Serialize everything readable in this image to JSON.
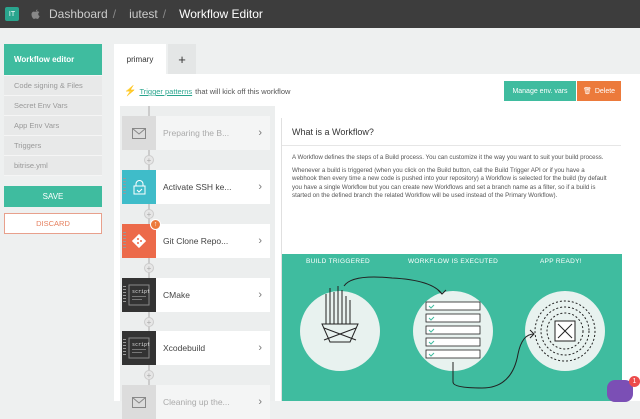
{
  "topbar": {
    "avatar": "IT",
    "breadcrumb": [
      "Dashboard",
      "iutest",
      "Workflow Editor"
    ]
  },
  "sidebar": {
    "items": [
      "Workflow editor",
      "Code signing & Files",
      "Secret Env Vars",
      "App Env Vars",
      "Triggers",
      "bitrise.yml"
    ],
    "save": "SAVE",
    "discard": "DISCARD"
  },
  "tabs": {
    "primary": "primary",
    "add": "+"
  },
  "trigger": {
    "link": "Trigger patterns",
    "text": "that will kick off this workflow"
  },
  "actions": {
    "env_vars": "Manage env. vars",
    "delete": "Delete"
  },
  "steps": [
    {
      "name": "Preparing the B...",
      "icon": "envelope-icon",
      "color": "#dcdcdc"
    },
    {
      "name": "Activate SSH ke...",
      "icon": "lock-icon",
      "color": "#3fbcc9"
    },
    {
      "name": "Git Clone Repo...",
      "icon": "git-icon",
      "color": "#ec6a4a",
      "badge": "↑"
    },
    {
      "name": "CMake",
      "icon": "script-icon",
      "color": "#333333"
    },
    {
      "name": "Xcodebuild",
      "icon": "script-icon",
      "color": "#333333"
    },
    {
      "name": "Cleaning up the...",
      "icon": "envelope-icon",
      "color": "#dcdcdc"
    }
  ],
  "info": {
    "title": "What is a Workflow?",
    "p1": "A Workflow defines the steps of a Build process. You can customize it the way you want to suit your build process.",
    "p2": "Whenever a build is triggered (when you click on the Build button, call the Build Trigger API or if you have a webhook then every time a new code is pushed into your repository) a Workflow is selected for the build (by default you have a single Workflow but you can create new Workflows and set a branch name as a filter, so if a build is started on the defined branch the related Workflow will be used instead of the Primary Workflow).",
    "labels": [
      "BUILD TRIGGERED",
      "WORKFLOW IS EXECUTED",
      "APP READY!"
    ]
  },
  "chat": {
    "count": "1"
  },
  "colors": {
    "accent": "#3fbc9f",
    "danger": "#ec7a3b"
  }
}
